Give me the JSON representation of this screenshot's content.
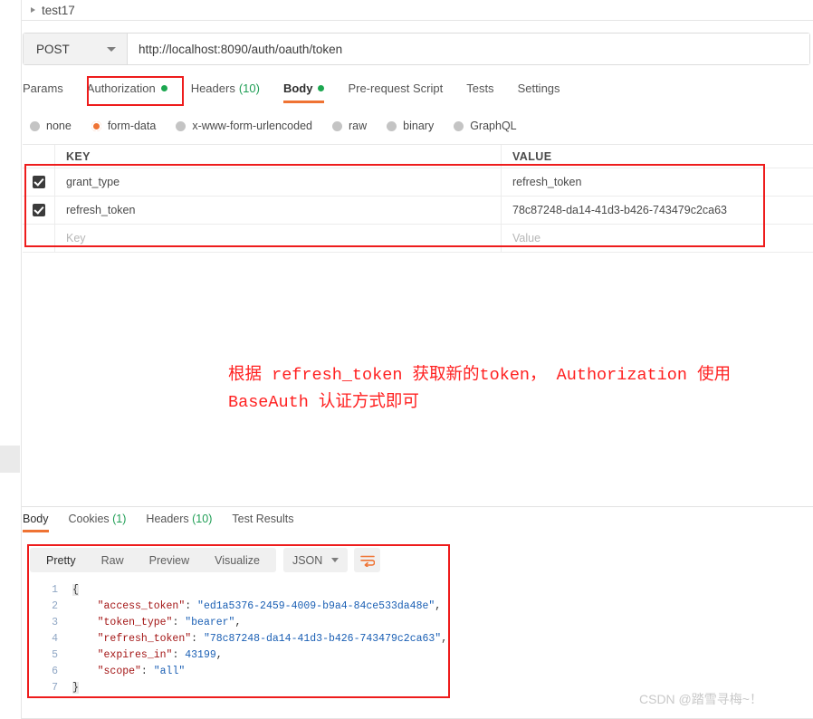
{
  "breadcrumb": {
    "label": "test17",
    "icon": "caret-right-icon"
  },
  "request": {
    "method": "POST",
    "url": "http://localhost:8090/auth/oauth/token",
    "tabs": [
      {
        "label": "Params",
        "active": false,
        "dot": false,
        "count": ""
      },
      {
        "label": "Authorization",
        "active": false,
        "dot": true,
        "count": ""
      },
      {
        "label": "Headers",
        "active": false,
        "dot": false,
        "count": "(10)"
      },
      {
        "label": "Body",
        "active": true,
        "dot": true,
        "count": ""
      },
      {
        "label": "Pre-request Script",
        "active": false,
        "dot": false,
        "count": ""
      },
      {
        "label": "Tests",
        "active": false,
        "dot": false,
        "count": ""
      },
      {
        "label": "Settings",
        "active": false,
        "dot": false,
        "count": ""
      }
    ],
    "body_types": [
      {
        "label": "none",
        "selected": false
      },
      {
        "label": "form-data",
        "selected": true
      },
      {
        "label": "x-www-form-urlencoded",
        "selected": false
      },
      {
        "label": "raw",
        "selected": false
      },
      {
        "label": "binary",
        "selected": false
      },
      {
        "label": "GraphQL",
        "selected": false
      }
    ],
    "table": {
      "headers": {
        "key": "KEY",
        "value": "VALUE"
      },
      "rows": [
        {
          "checked": true,
          "key": "grant_type",
          "value": "refresh_token"
        },
        {
          "checked": true,
          "key": "refresh_token",
          "value": "78c87248-da14-41d3-b426-743479c2ca63"
        }
      ],
      "placeholder": {
        "key": "Key",
        "value": "Value"
      }
    }
  },
  "annotation": {
    "text": "根据 refresh_token 获取新的token， Authorization 使用BaseAuth 认证方式即可",
    "color": "#ff2020"
  },
  "response": {
    "tabs": [
      {
        "label": "Body",
        "count": "",
        "active": true
      },
      {
        "label": "Cookies",
        "count": "(1)",
        "active": false
      },
      {
        "label": "Headers",
        "count": "(10)",
        "active": false
      },
      {
        "label": "Test Results",
        "count": "",
        "active": false
      }
    ],
    "view_modes": [
      {
        "label": "Pretty",
        "active": true
      },
      {
        "label": "Raw",
        "active": false
      },
      {
        "label": "Preview",
        "active": false
      },
      {
        "label": "Visualize",
        "active": false
      }
    ],
    "format": "JSON",
    "wrap_icon": "wrap-text-icon",
    "json_lines": [
      {
        "n": "1",
        "segments": [
          {
            "t": "{",
            "c": "brace"
          }
        ]
      },
      {
        "n": "2",
        "segments": [
          {
            "t": "    ",
            "c": "ct"
          },
          {
            "t": "\"access_token\"",
            "c": "k"
          },
          {
            "t": ": ",
            "c": "p"
          },
          {
            "t": "\"ed1a5376-2459-4009-b9a4-84ce533da48e\"",
            "c": "s"
          },
          {
            "t": ",",
            "c": "p"
          }
        ]
      },
      {
        "n": "3",
        "segments": [
          {
            "t": "    ",
            "c": "ct"
          },
          {
            "t": "\"token_type\"",
            "c": "k"
          },
          {
            "t": ": ",
            "c": "p"
          },
          {
            "t": "\"bearer\"",
            "c": "s"
          },
          {
            "t": ",",
            "c": "p"
          }
        ]
      },
      {
        "n": "4",
        "segments": [
          {
            "t": "    ",
            "c": "ct"
          },
          {
            "t": "\"refresh_token\"",
            "c": "k"
          },
          {
            "t": ": ",
            "c": "p"
          },
          {
            "t": "\"78c87248-da14-41d3-b426-743479c2ca63\"",
            "c": "s"
          },
          {
            "t": ",",
            "c": "p"
          }
        ]
      },
      {
        "n": "5",
        "segments": [
          {
            "t": "    ",
            "c": "ct"
          },
          {
            "t": "\"expires_in\"",
            "c": "k"
          },
          {
            "t": ": ",
            "c": "p"
          },
          {
            "t": "43199",
            "c": "n"
          },
          {
            "t": ",",
            "c": "p"
          }
        ]
      },
      {
        "n": "6",
        "segments": [
          {
            "t": "    ",
            "c": "ct"
          },
          {
            "t": "\"scope\"",
            "c": "k"
          },
          {
            "t": ": ",
            "c": "p"
          },
          {
            "t": "\"all\"",
            "c": "s"
          }
        ]
      },
      {
        "n": "7",
        "segments": [
          {
            "t": "}",
            "c": "brace"
          }
        ]
      }
    ]
  },
  "watermark": "CSDN @踏雪寻梅~！",
  "colors": {
    "accent": "#ef7333",
    "annotation_red": "#ee1c1c",
    "status_green": "#1ca750",
    "count_green": "#1f9e55"
  }
}
